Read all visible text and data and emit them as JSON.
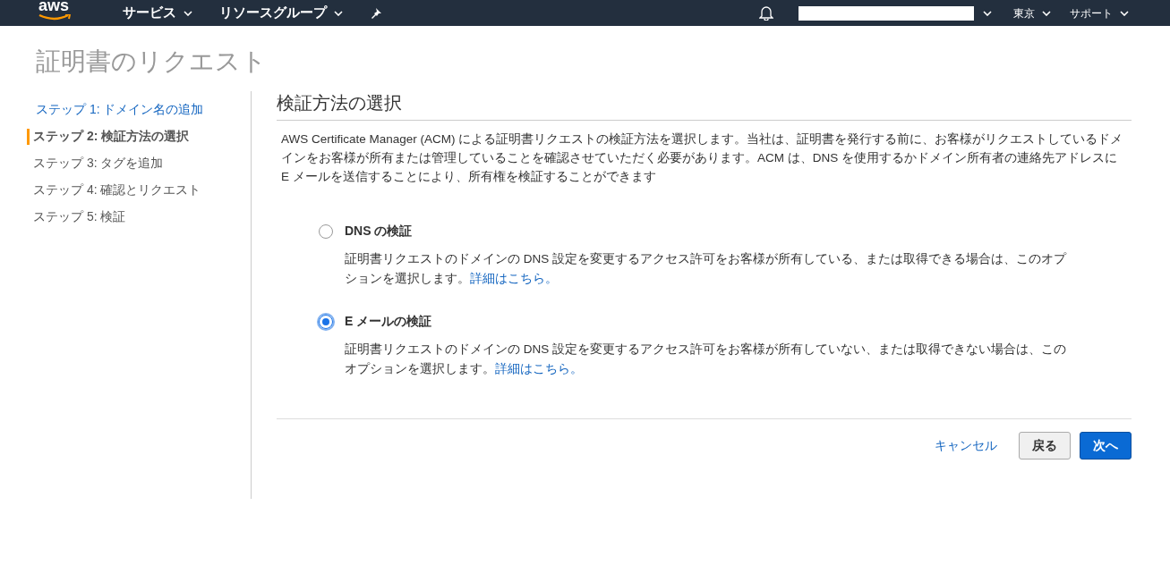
{
  "top_bar": {
    "logo": "aws",
    "menus": [
      {
        "label": "サービス"
      },
      {
        "label": "リソースグループ"
      }
    ],
    "region": "東京",
    "support": "サポート"
  },
  "page_title": "証明書のリクエスト",
  "steps": [
    {
      "label": "ステップ 1: ドメイン名の追加",
      "selected": false,
      "kind": "link"
    },
    {
      "label": "ステップ 2: 検証方法の選択",
      "selected": true,
      "kind": "text"
    },
    {
      "label": "ステップ 3: タグを追加",
      "selected": false,
      "kind": "text"
    },
    {
      "label": "ステップ 4: 確認とリクエスト",
      "selected": false,
      "kind": "text"
    },
    {
      "label": "ステップ 5: 検証",
      "selected": false,
      "kind": "text"
    }
  ],
  "section_title": "検証方法の選択",
  "intro": "AWS Certificate Manager (ACM) による証明書リクエストの検証方法を選択します。当社は、証明書を発行する前に、お客様がリクエストしているドメインをお客様が所有または管理していることを確認させていただく必要があります。ACM は、DNS を使用するかドメイン所有者の連絡先アドレスに E メールを送信することにより、所有権を検証することができます",
  "options": [
    {
      "label": "DNS の検証",
      "selected": false,
      "description": "証明書リクエストのドメインの DNS 設定を変更するアクセス許可をお客様が所有している、または取得できる場合は、このオプションを選択します。",
      "link": "詳細はこちら。"
    },
    {
      "label": "E メールの検証",
      "selected": true,
      "description": "証明書リクエストのドメインの DNS 設定を変更するアクセス許可をお客様が所有していない、または取得できない場合は、このオプションを選択します。",
      "link": "詳細はこちら。"
    }
  ],
  "buttons": {
    "cancel": "キャンセル",
    "back": "戻る",
    "next": "次へ"
  }
}
